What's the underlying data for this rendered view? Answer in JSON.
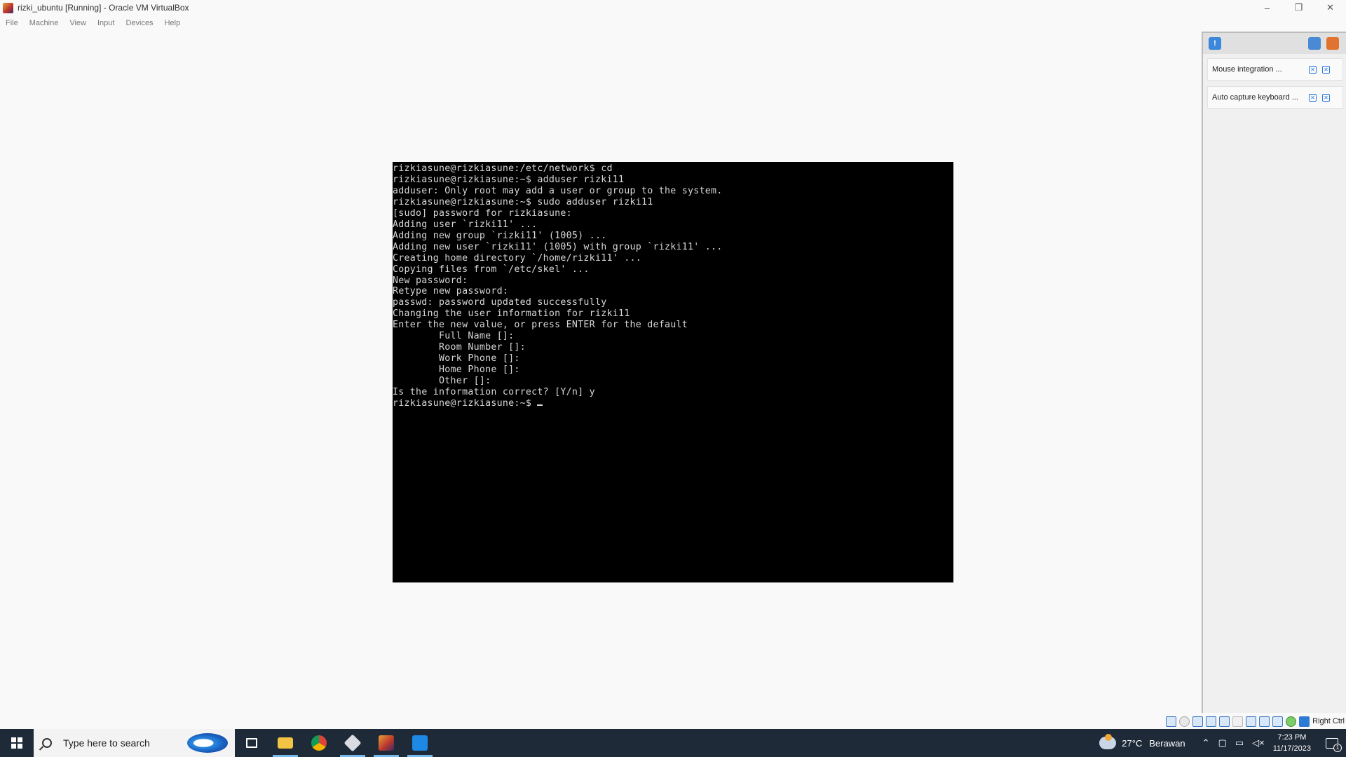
{
  "window": {
    "title": "rizki_ubuntu [Running] - Oracle VM VirtualBox",
    "minimize": "–",
    "restore": "❐",
    "close": "✕"
  },
  "menu": [
    "File",
    "Machine",
    "View",
    "Input",
    "Devices",
    "Help"
  ],
  "terminal": {
    "lines": [
      "rizkiasune@rizkiasune:/etc/network$ cd",
      "rizkiasune@rizkiasune:~$ adduser rizki11",
      "adduser: Only root may add a user or group to the system.",
      "rizkiasune@rizkiasune:~$ sudo adduser rizki11",
      "[sudo] password for rizkiasune:",
      "Adding user `rizki11' ...",
      "Adding new group `rizki11' (1005) ...",
      "Adding new user `rizki11' (1005) with group `rizki11' ...",
      "Creating home directory `/home/rizki11' ...",
      "Copying files from `/etc/skel' ...",
      "New password:",
      "Retype new password:",
      "passwd: password updated successfully",
      "Changing the user information for rizki11",
      "Enter the new value, or press ENTER for the default",
      "        Full Name []:",
      "        Room Number []:",
      "        Work Phone []:",
      "        Home Phone []:",
      "        Other []:",
      "Is the information correct? [Y/n] y"
    ],
    "prompt": "rizkiasune@rizkiasune:~$ "
  },
  "notifications": {
    "items": [
      {
        "text": "Mouse integration ..."
      },
      {
        "text": "Auto capture keyboard ..."
      }
    ]
  },
  "statusbar": {
    "host_key": "Right Ctrl"
  },
  "taskbar": {
    "search_placeholder": "Type here to search",
    "weather_temp": "27°C",
    "weather_desc": "Berawan",
    "time": "7:23 PM",
    "date": "11/17/2023",
    "notification_count": "1"
  },
  "colors": {
    "taskbar_bg": "#1f2a38",
    "terminal_bg": "#000000",
    "terminal_fg": "#d7d7d7",
    "accent": "#2d7bd8"
  }
}
